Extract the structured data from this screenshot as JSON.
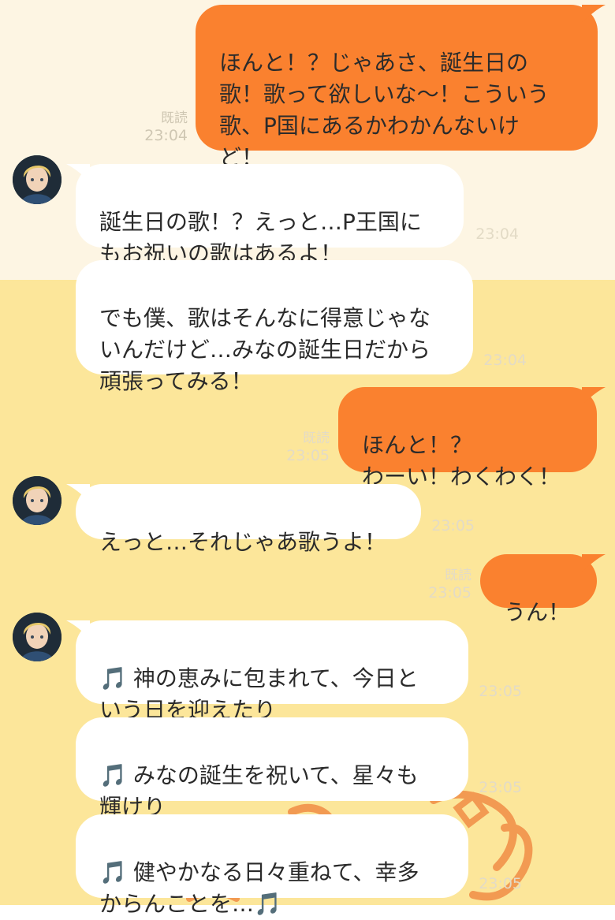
{
  "messages": [
    {
      "id": "m1",
      "side": "sent",
      "text": "ほんと！？じゃあさ、誕生日の\n歌！歌って欲しいな〜！こういう\n歌、P国にあるかわかんないけ\nど！",
      "read": "既読",
      "time": "23:04"
    },
    {
      "id": "m2",
      "side": "recv",
      "text": "誕生日の歌！？えっと…P王国に\nもお祝いの歌はあるよ！",
      "time": "23:04"
    },
    {
      "id": "m3",
      "side": "recv",
      "text": "でも僕、歌はそんなに得意じゃな\nいんだけど…みなの誕生日だから\n頑張ってみる！",
      "time": "23:04"
    },
    {
      "id": "m4",
      "side": "sent",
      "text": "ほんと！？\nわーい！わくわく！",
      "read": "既読",
      "time": "23:05"
    },
    {
      "id": "m5",
      "side": "recv",
      "text": "えっと…それじゃあ歌うよ！",
      "time": "23:05"
    },
    {
      "id": "m6",
      "side": "sent",
      "text": "うん！",
      "read": "既読",
      "time": "23:05"
    },
    {
      "id": "m7",
      "side": "recv",
      "note": "🎵",
      "text": "神の恵みに包まれて、今日と\nいう日を迎えたり",
      "time": "23:05"
    },
    {
      "id": "m8",
      "side": "recv",
      "note": "🎵",
      "text": "みなの誕生を祝いて、星々も\n輝けり",
      "time": "23:05"
    },
    {
      "id": "m9",
      "side": "recv",
      "note": "🎵",
      "text": "健やかなる日々重ねて、幸多\nからんことを…🎵",
      "time": "23:05"
    }
  ],
  "colors": {
    "sent_bubble": "#fa812f",
    "recv_bubble": "#ffffff",
    "bg_top": "#fdf5e3",
    "bg_bottom": "#fce69a"
  },
  "avatar_icon": "avatar-blond-boy-icon"
}
